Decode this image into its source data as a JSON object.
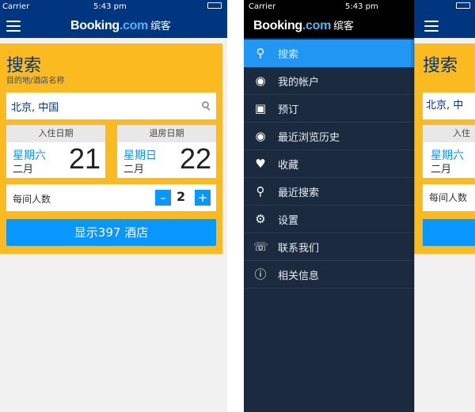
{
  "status": {
    "carrier": "Carrier",
    "time": "5:43 pm",
    "signal_icon": "wifi-icon"
  },
  "brand": {
    "name_main": "Booking",
    "name_dot": ".com",
    "name_cn": "缤客"
  },
  "search": {
    "title": "搜索",
    "subtitle": "目的地/酒店名称",
    "destination_value": "北京, 中国",
    "checkin": {
      "header": "入住日期",
      "weekday": "星期六",
      "month": "二月",
      "day": "21"
    },
    "checkout": {
      "header": "退房日期",
      "weekday": "星期日",
      "month": "二月",
      "day": "22"
    },
    "guests": {
      "label": "每间人数",
      "value": "2",
      "minus": "–",
      "plus": "+"
    },
    "show_button": "显示397 酒店"
  },
  "menu": {
    "items": [
      {
        "label": "搜索",
        "icon": "search-icon"
      },
      {
        "label": "我的帐户",
        "icon": "user-icon"
      },
      {
        "label": "预订",
        "icon": "briefcase-icon"
      },
      {
        "label": "最近浏览历史",
        "icon": "eye-icon"
      },
      {
        "label": "收藏",
        "icon": "heart-icon"
      },
      {
        "label": "最近搜索",
        "icon": "search-icon"
      },
      {
        "label": "设置",
        "icon": "gear-icon"
      },
      {
        "label": "联系我们",
        "icon": "headset-icon"
      },
      {
        "label": "相关信息",
        "icon": "info-icon"
      }
    ]
  },
  "peek_left": {
    "title": "搜索",
    "destination": "北京, 中",
    "checkin_header": "入住",
    "weekday": "星期六",
    "month": "二月",
    "guests_label": "每间人数"
  },
  "colors": {
    "nav": "#003580",
    "accent": "#fbbb20",
    "button": "#0896ff",
    "menu_bg": "#1b2a3e",
    "menu_active": "#2196f3"
  }
}
